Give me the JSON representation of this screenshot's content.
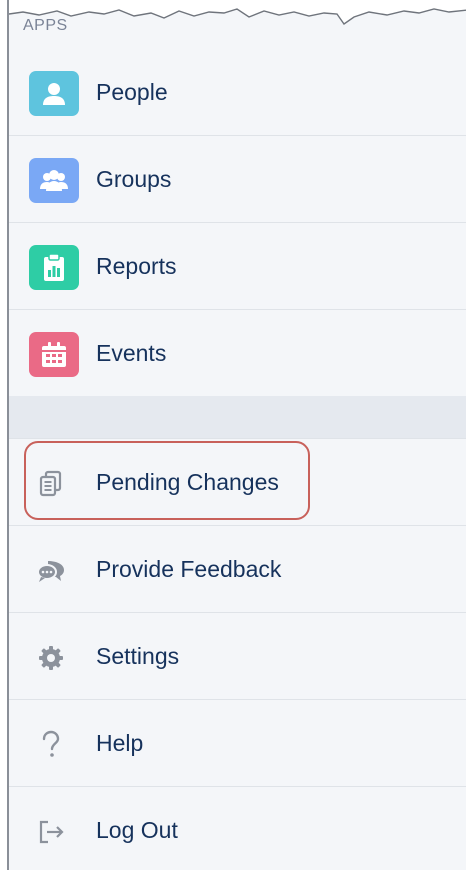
{
  "section_label": "APPS",
  "apps": [
    {
      "label": "People",
      "icon": "person-icon",
      "color": "#5ec4de"
    },
    {
      "label": "Groups",
      "icon": "groups-icon",
      "color": "#7aa8f5"
    },
    {
      "label": "Reports",
      "icon": "reports-icon",
      "color": "#2ecda5"
    },
    {
      "label": "Events",
      "icon": "calendar-icon",
      "color": "#ea6a86"
    }
  ],
  "utilities": [
    {
      "label": "Pending Changes",
      "icon": "pending-changes-icon"
    },
    {
      "label": "Provide Feedback",
      "icon": "feedback-icon"
    },
    {
      "label": "Settings",
      "icon": "gear-icon"
    },
    {
      "label": "Help",
      "icon": "help-icon"
    },
    {
      "label": "Log Out",
      "icon": "logout-icon"
    }
  ],
  "colors": {
    "label_text": "#16325c",
    "section_text": "#7a8396",
    "utility_icon": "#8c929c",
    "highlight_border": "#c8615b",
    "background": "#f4f6f9"
  }
}
